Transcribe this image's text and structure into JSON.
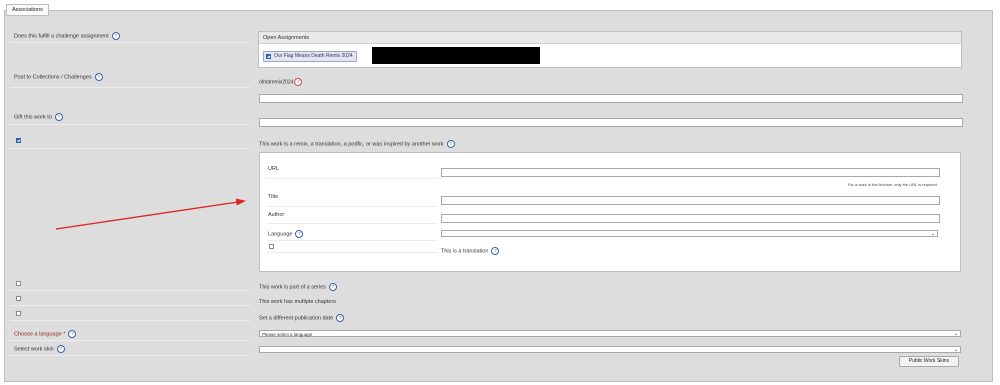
{
  "section": {
    "legend": "Associations"
  },
  "fields": {
    "challenge_label": "Does this fulfill a challenge assignment",
    "collections_label": "Post to Collections / Challenges",
    "gift_label": "Gift this work to",
    "series_label": "This work is part of a series",
    "chapters_label": "This work has multiple chapters",
    "pubdate_label": "Set a different publication date",
    "language_label": "Choose a language",
    "language_required": "*",
    "skin_label": "Select work skin"
  },
  "assignments": {
    "header": "Open Assignments",
    "item_label": "Our Flag Means Death Remix 2024",
    "item_checked": true
  },
  "collections": {
    "tag": "ofmdremix2024",
    "remove_symbol": "×"
  },
  "parent_work": {
    "checkbox_checked": true,
    "label": "This work is a remix, a translation, a podfic, or was inspired by another work",
    "url_label": "URL",
    "url_note": "For a work in the Archive, only the URL is required.",
    "title_label": "Title",
    "author_label": "Author",
    "language_label": "Language",
    "language_selected": "",
    "translation_label": "This is a translation",
    "translation_checked": false
  },
  "language_select": {
    "selected": "Please select a language"
  },
  "skin_select": {
    "selected": ""
  },
  "public_skins_button": "Public Work Skins",
  "help_symbol": "?",
  "chevron": "⌄",
  "colors": {
    "background": "#dddddd",
    "panel": "#ffffff",
    "accent": "#3b62a8",
    "required": "#8f1f1f",
    "arrow": "#dd2222"
  }
}
